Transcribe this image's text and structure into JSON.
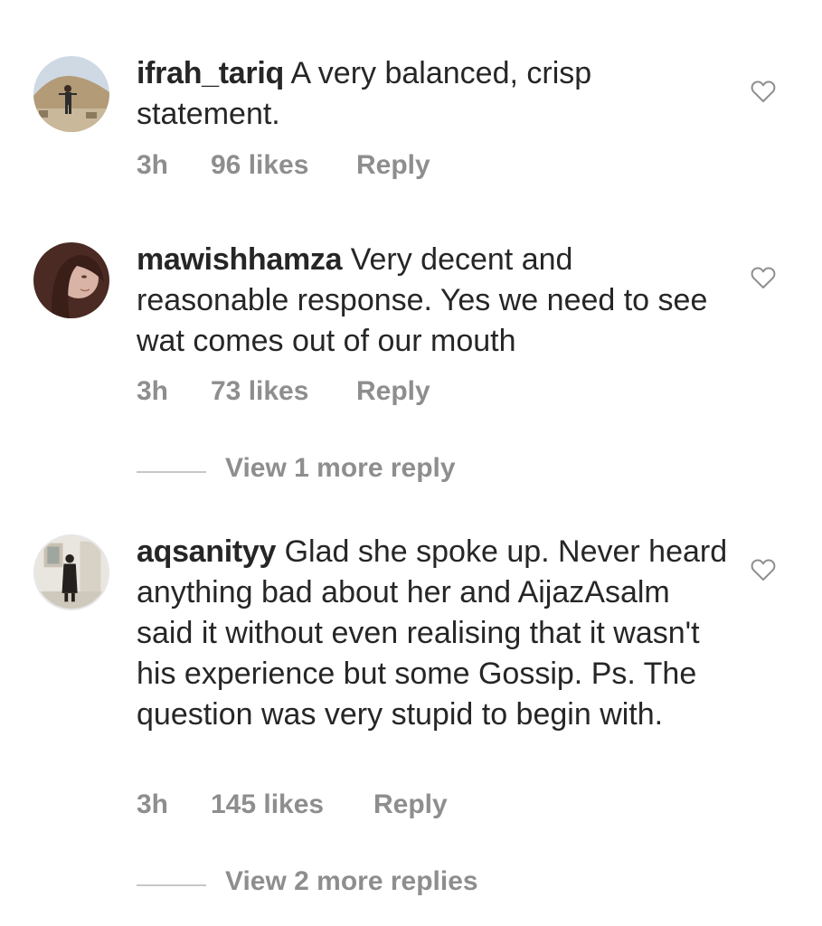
{
  "comments": [
    {
      "username": "ifrah_tariq",
      "text": "A very balanced, crisp statement.",
      "time": "3h",
      "likes": "96 likes",
      "reply_label": "Reply",
      "avatar_icon": "profile-photo"
    },
    {
      "username": "mawishhamza",
      "text": "Very decent and reasonable response. Yes we need to see wat comes out of our mouth",
      "time": "3h",
      "likes": "73 likes",
      "reply_label": "Reply",
      "avatar_icon": "profile-photo",
      "view_more": "View 1 more reply"
    },
    {
      "username": "aqsanityy",
      "text": "Glad she spoke up. Never heard anything bad about her and AijazAsalm said it without even realising that it wasn't his experience but some Gossip. Ps. The question was very stupid to begin with.",
      "time": "3h",
      "likes": "145 likes",
      "reply_label": "Reply",
      "avatar_icon": "profile-photo",
      "view_more": "View 2 more replies"
    }
  ],
  "icons": {
    "like": "heart-outline-icon"
  },
  "colors": {
    "text": "#262626",
    "secondary": "#8e8e8e",
    "divider": "#c7c7c7"
  }
}
